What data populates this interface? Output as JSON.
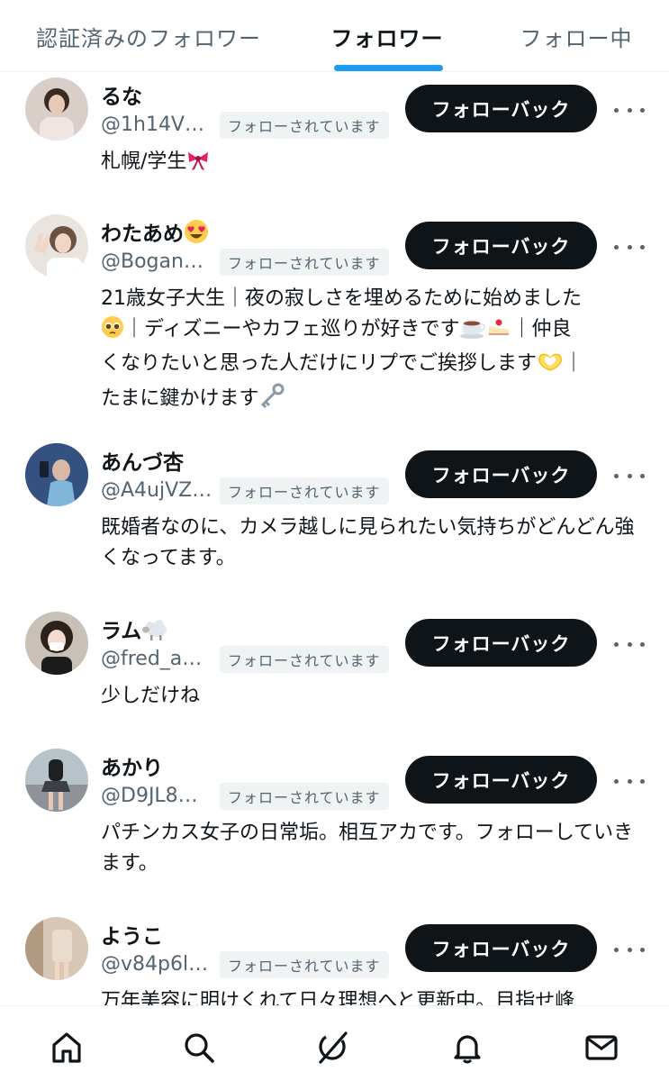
{
  "tabs": [
    {
      "label": "認証済みのフォロワー",
      "active": false
    },
    {
      "label": "フォロワー",
      "active": true
    },
    {
      "label": "フォロー中",
      "active": false
    }
  ],
  "accent_color": "#1d9bf0",
  "users": [
    {
      "name": "るな",
      "handle": "@1h14V…",
      "follows_you_label": "フォローされています",
      "button_label": "フォローバック",
      "bio": "札幌/学生",
      "bio_emoji": [
        "ribbon"
      ]
    },
    {
      "name": "わたあめ",
      "name_emoji": [
        "heart-eyes-face"
      ],
      "handle": "@Bogan…",
      "follows_you_label": "フォローされています",
      "button_label": "フォローバック",
      "bio_lines": [
        "21歳女子大生｜夜の寂しさを埋めるために始めました",
        "｜ディズニーやカフェ巡りが好きです",
        "｜仲良",
        "くなりたいと思った人だけにリプでご挨拶します",
        "｜",
        "たまに鍵かけます"
      ],
      "bio_emoji": [
        "pleading-face",
        "coffee",
        "cake",
        "heart-hands",
        "old-key"
      ]
    },
    {
      "name": "あんづ杏",
      "handle": "@A4ujVZ…",
      "follows_you_label": "フォローされています",
      "button_label": "フォローバック",
      "bio": "既婚者なのに、カメラ越しに見られたい気持ちがどんどん強くなってます。"
    },
    {
      "name": "ラム",
      "name_emoji": [
        "sheep"
      ],
      "handle": "@fred_a…",
      "follows_you_label": "フォローされています",
      "button_label": "フォローバック",
      "bio": "少しだけね"
    },
    {
      "name": "あかり",
      "handle": "@D9JL8…",
      "follows_you_label": "フォローされています",
      "button_label": "フォローバック",
      "bio": "パチンカス女子の日常垢。相互アカです。フォローしていきます。"
    },
    {
      "name": "ようこ",
      "handle": "@v84p6l…",
      "follows_you_label": "フォローされています",
      "button_label": "フォローバック",
      "bio": "万年美容に明けくれて日々理想へと更新中。目指せ峰"
    }
  ],
  "bottom_nav": [
    "home-icon",
    "search-icon",
    "grok-icon",
    "notifications-icon",
    "messages-icon"
  ]
}
